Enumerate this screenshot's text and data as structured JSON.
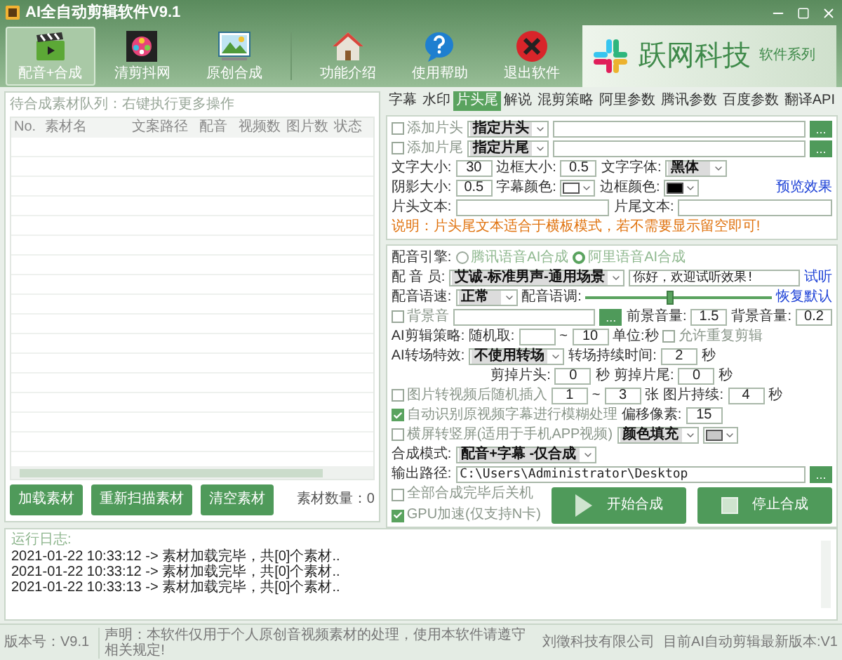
{
  "window": {
    "title": "AI全自动剪辑软件V9.1"
  },
  "toolbar": [
    {
      "label": "配音+合成",
      "selected": true
    },
    {
      "label": "清剪抖网",
      "selected": false
    },
    {
      "label": "原创合成",
      "selected": false
    },
    {
      "label": "功能介绍",
      "selected": false
    },
    {
      "label": "使用帮助",
      "selected": false
    },
    {
      "label": "退出软件",
      "selected": false
    }
  ],
  "banner": {
    "brand": "跃网科技",
    "tagline": "软件系列"
  },
  "queue": {
    "title": "待合成素材队列：右键执行更多操作",
    "columns": [
      "No.",
      "素材名",
      "文案路径",
      "配音",
      "视频数",
      "图片数",
      "状态"
    ],
    "buttons": [
      "加载素材",
      "重新扫描素材",
      "清空素材"
    ],
    "count": "素材数量：0"
  },
  "tabs": [
    {
      "label": "字幕",
      "selected": false
    },
    {
      "label": "水印",
      "selected": false
    },
    {
      "label": "片头尾",
      "selected": true
    },
    {
      "label": "解说",
      "selected": false
    },
    {
      "label": "混剪策略",
      "selected": false
    },
    {
      "label": "阿里参数",
      "selected": false
    },
    {
      "label": "腾讯参数",
      "selected": false
    },
    {
      "label": "百度参数",
      "selected": false
    },
    {
      "label": "翻译API",
      "selected": false
    }
  ],
  "intro_outro": {
    "rows": [
      {
        "items": [
          {
            "kind": "checkbox",
            "label": "添加片头",
            "checked": false
          },
          {
            "kind": "select",
            "value": "指定片头"
          },
          {
            "kind": "text"
          },
          {
            "kind": "browse",
            "text": "..."
          }
        ]
      },
      {
        "items": [
          {
            "kind": "checkbox",
            "label": "添加片尾",
            "checked": false
          },
          {
            "kind": "select",
            "value": "指定片尾"
          },
          {
            "kind": "text"
          },
          {
            "kind": "browse",
            "text": "..."
          }
        ]
      },
      {
        "items": [
          {
            "kind": "label",
            "text": "文字大小:"
          },
          {
            "kind": "number",
            "value": "30"
          },
          {
            "kind": "label",
            "text": "边框大小:"
          },
          {
            "kind": "number",
            "value": "0.5"
          },
          {
            "kind": "label",
            "text": "文字字体:"
          },
          {
            "kind": "select",
            "value": "黑体"
          }
        ]
      },
      {
        "items": [
          {
            "kind": "label",
            "text": "阴影大小:"
          },
          {
            "kind": "number",
            "value": "0.5"
          },
          {
            "kind": "label",
            "text": "字幕颜色:"
          },
          {
            "kind": "swatch",
            "color": "#ffffff"
          },
          {
            "kind": "label",
            "text": "边框颜色:"
          },
          {
            "kind": "swatch",
            "color": "#000000"
          },
          {
            "kind": "spacer"
          },
          {
            "kind": "link",
            "text": "预览效果"
          }
        ]
      },
      {
        "items": [
          {
            "kind": "label",
            "text": "片头文本:"
          },
          {
            "kind": "text"
          },
          {
            "kind": "label",
            "text": "片尾文本:"
          },
          {
            "kind": "text"
          }
        ]
      },
      {
        "items": [
          {
            "kind": "note",
            "text": "说明：片头尾文本适合于横板模式，若不需要显示留空即可!"
          }
        ]
      }
    ]
  },
  "voice": {
    "rows": [
      {
        "items": [
          {
            "kind": "label",
            "text": "配音引擎:"
          },
          {
            "kind": "radio",
            "label": "腾讯语音AI合成",
            "selected": false
          },
          {
            "kind": "radio",
            "label": "阿里语音AI合成",
            "selected": true
          }
        ]
      },
      {
        "items": [
          {
            "kind": "label",
            "text": "配 音 员:"
          },
          {
            "kind": "select",
            "value": "艾诚-标准男声-通用场景"
          },
          {
            "kind": "text",
            "value": "你好，欢迎试听效果!"
          },
          {
            "kind": "link",
            "text": "试听"
          }
        ]
      },
      {
        "items": [
          {
            "kind": "label",
            "text": "配音语速:"
          },
          {
            "kind": "select",
            "value": "正常"
          },
          {
            "kind": "label",
            "text": "配音语调:"
          },
          {
            "kind": "slider",
            "level": 0.45
          },
          {
            "kind": "link",
            "text": "恢复默认"
          }
        ]
      },
      {
        "items": [
          {
            "kind": "checkbox",
            "label": "背景音",
            "checked": false
          },
          {
            "kind": "text"
          },
          {
            "kind": "browse",
            "text": "..."
          },
          {
            "kind": "label",
            "text": "前景音量:"
          },
          {
            "kind": "number",
            "value": "1.5"
          },
          {
            "kind": "label",
            "text": "背景音量:"
          },
          {
            "kind": "number",
            "value": "0.2"
          }
        ]
      },
      {
        "items": [
          {
            "kind": "label",
            "text": "AI剪辑策略: 随机取:"
          },
          {
            "kind": "number"
          },
          {
            "kind": "label",
            "text": "~"
          },
          {
            "kind": "number",
            "value": "10"
          },
          {
            "kind": "label",
            "text": "单位:秒"
          },
          {
            "kind": "checkbox",
            "label": "允许重复剪辑",
            "checked": false
          }
        ]
      },
      {
        "items": [
          {
            "kind": "label",
            "text": "AI转场特效:"
          },
          {
            "kind": "select",
            "value": "不使用转场"
          },
          {
            "kind": "label",
            "text": "转场持续时间:"
          },
          {
            "kind": "number",
            "value": "2"
          },
          {
            "kind": "label",
            "text": "秒"
          }
        ]
      },
      {
        "items": [
          {
            "kind": "spacer"
          },
          {
            "kind": "label",
            "text": "剪掉片头:"
          },
          {
            "kind": "number",
            "value": "0"
          },
          {
            "kind": "label",
            "text": "秒"
          },
          {
            "kind": "label",
            "text": "剪掉片尾:"
          },
          {
            "kind": "number",
            "value": "0"
          },
          {
            "kind": "label",
            "text": "秒"
          },
          {
            "kind": "spacer"
          }
        ]
      },
      {
        "items": [
          {
            "kind": "checkbox",
            "label": "图片转视频后随机插入",
            "checked": false
          },
          {
            "kind": "number",
            "value": "1"
          },
          {
            "kind": "label",
            "text": "~"
          },
          {
            "kind": "number",
            "value": "3"
          },
          {
            "kind": "label",
            "text": "张"
          },
          {
            "kind": "label",
            "text": "图片持续:"
          },
          {
            "kind": "number",
            "value": "4"
          },
          {
            "kind": "label",
            "text": "秒"
          }
        ]
      },
      {
        "items": [
          {
            "kind": "checkbox",
            "label": "自动识别原视频字幕进行模糊处理",
            "checked": true
          },
          {
            "kind": "label",
            "text": "偏移像素:"
          },
          {
            "kind": "number",
            "value": "15"
          }
        ]
      },
      {
        "items": [
          {
            "kind": "checkbox",
            "label": "横屏转竖屏(适用于手机APP视频)",
            "checked": false
          },
          {
            "kind": "select",
            "value": "颜色填充"
          },
          {
            "kind": "swatch",
            "color": "#c8c8c8"
          }
        ]
      },
      {
        "items": [
          {
            "kind": "label",
            "text": "合成模式:"
          },
          {
            "kind": "select",
            "value": "配音+字幕 -仅合成"
          }
        ]
      },
      {
        "items": [
          {
            "kind": "label",
            "text": "输出路径:"
          },
          {
            "kind": "text",
            "value": "C:\\Users\\Administrator\\Desktop"
          },
          {
            "kind": "browse",
            "text": "..."
          }
        ]
      }
    ]
  },
  "actions": {
    "options": [
      {
        "label": "全部合成完毕后关机",
        "checked": false
      },
      {
        "label": "GPU加速(仅支持N卡)",
        "checked": true
      }
    ],
    "buttons": [
      {
        "label": "开始合成",
        "kind": "start"
      },
      {
        "label": "停止合成",
        "kind": "stop"
      }
    ]
  },
  "log": {
    "title": "运行日志:",
    "lines": [
      "2021-01-22 10:33:12 -> 素材加载完毕，共[0]个素材..",
      "2021-01-22 10:33:12 -> 素材加载完毕，共[0]个素材..",
      "2021-01-22 10:33:13 -> 素材加载完毕，共[0]个素材.."
    ]
  },
  "status_bar": {
    "version": "版本号：V9.1",
    "notice": "声明：本软件仅用于个人原创音视频素材的处理，使用本软件请遵守相关规定!",
    "company": "刘徵科技有限公司",
    "latest": "目前AI自动剪辑最新版本:V1"
  }
}
